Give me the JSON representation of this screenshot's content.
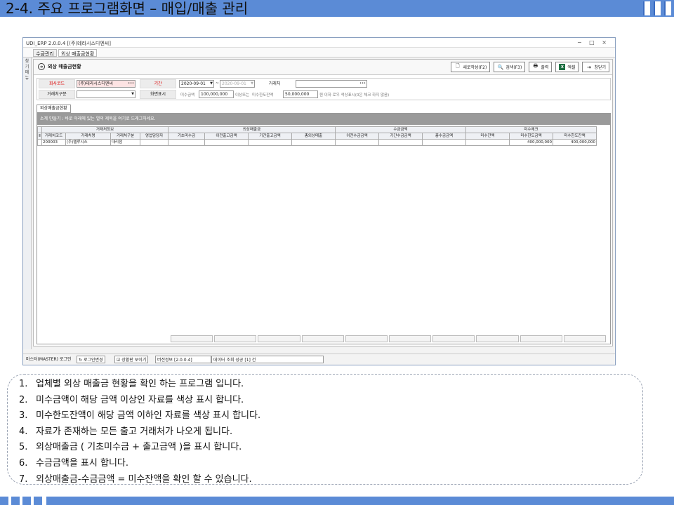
{
  "slide": {
    "title": "2-4. 주요 프로그램화면 – 매입/매출 관리"
  },
  "window": {
    "title": "UDI_ERP 2.0.0.4 [(주)테라시스디엔씨]",
    "controls": "− □ ×",
    "menu_tabs": [
      "수금관리",
      "외상 매출금현황"
    ],
    "side_labels": [
      "즐",
      "겨",
      "찾",
      "기",
      "메",
      "뉴"
    ]
  },
  "toolbar": {
    "page_title": "외상 매출금현황",
    "buttons": [
      {
        "label": "새로작성(F2)",
        "icon": "new-doc-icon"
      },
      {
        "label": "검색(F3)",
        "icon": "search-icon"
      },
      {
        "label": "출력",
        "icon": "printer-icon"
      },
      {
        "label": "엑셀",
        "icon": "excel-icon"
      },
      {
        "label": "창닫기",
        "icon": "exit-icon"
      }
    ]
  },
  "filter": {
    "company_label": "회사코드",
    "company_value": "(주)테라시스디엔씨",
    "period_label": "기간",
    "date_from": "2020-09-01",
    "date_sep": "~",
    "date_to": "2020-09-01",
    "vendor_label": "거래처",
    "vendor_value": "",
    "vendor_type_label": "거래처구분",
    "vendor_type_value": "",
    "display_label": "화면표시",
    "unpaid_label": "미수금액",
    "unpaid_value": "100,000,000",
    "unpaid_suffix": "이상또는",
    "limit_label": "미수한도잔액",
    "limit_value": "50,000,000",
    "limit_suffix": "원 이하 로우 색상표시(0은 체크 하지 않음)"
  },
  "grid": {
    "tab_label": "외상매출금현황",
    "grouping_hint": "소계 만들기 : 바로 아래에 있는 열의 제목을 여기로 드래그하세요.",
    "groups": [
      "거래처정보",
      "외상매출금",
      "수금금액",
      "미수체크"
    ],
    "columns": [
      "거래처코드",
      "거래처명",
      "거래처구분",
      "영업담당자",
      "기초미수금",
      "이전출고금액",
      "기간출고금액",
      "총외상매출",
      "이전수금금액",
      "기간수금금액",
      "총수금금액",
      "미수잔액",
      "미수한도금액",
      "미수한도잔액"
    ],
    "rows": [
      [
        "200003",
        "(주)엘루시스",
        "대리점",
        "",
        "",
        "",
        "",
        "",
        "",
        "",
        "",
        "",
        "400,000,000",
        "400,000,000"
      ]
    ]
  },
  "status": {
    "user": "마스터(MASTER) 로그인",
    "login_change": "로그인변경",
    "show_status": "상황판 보이기",
    "version": "버전정보 [2.0.0.4]",
    "message": "데이터 조회 성공 [1] 건"
  },
  "notes": [
    "업체별 외상 매출금 현황을 확인 하는 프로그램 입니다.",
    "미수금액이 해당 금액 이상인 자료를 색상 표시 합니다.",
    "미수한도잔액이 해당 금액 이하인 자료를 색상 표시 합니다.",
    "자료가 존재하는 모든 출고 거래처가 나오게 됩니다.",
    "외상매출금 ( 기초미수금 + 출고금액 )을 표시 합니다.",
    "수금금액을 표시 합니다.",
    "외상매출금-수금금액 = 미수잔액을 확인 할 수 있습니다."
  ]
}
